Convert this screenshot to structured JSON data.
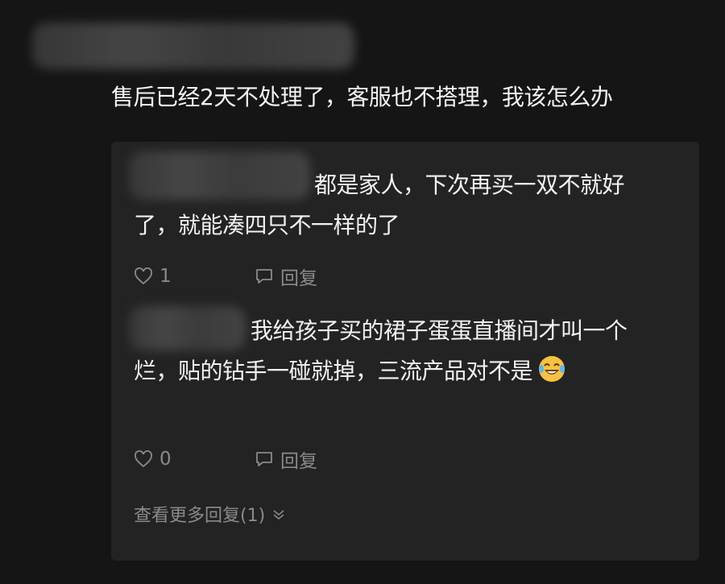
{
  "main_comment": {
    "text": "售后已经2天不处理了，客服也不搭理，我该怎么办"
  },
  "replies": [
    {
      "text": "都是家人，下次再买一双不就好了，就能凑四只不一样的了",
      "likes": "1",
      "reply_label": "回复"
    },
    {
      "text": "我给孩子买的裙子蛋蛋直播间才叫一个烂，贴的钻手一碰就掉，三流产品对不是",
      "emoji": "laughing-tears-emoji",
      "likes": "0",
      "reply_label": "回复"
    }
  ],
  "more_replies": {
    "label": "查看更多回复(1)"
  },
  "colors": {
    "background": "#151515",
    "panel": "#232323",
    "text": "#f2f2f2",
    "meta": "#8a8a8a"
  }
}
